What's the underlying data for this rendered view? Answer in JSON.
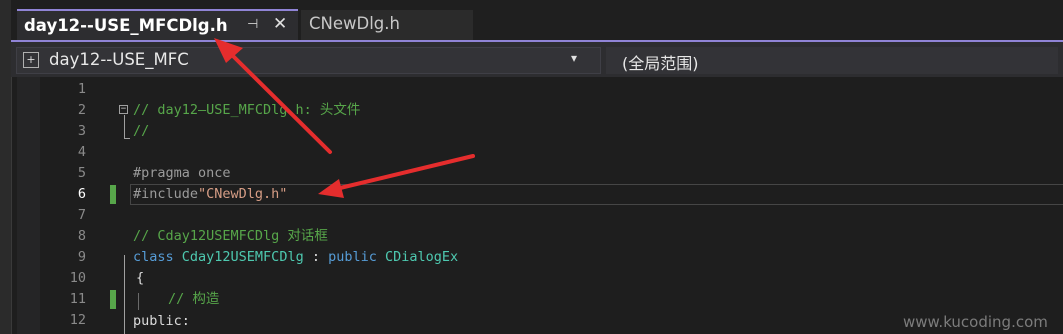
{
  "tabs": [
    {
      "label": "day12--USE_MFCDlg.h",
      "active": true,
      "pin_glyph": "⊣",
      "close_glyph": "✕"
    },
    {
      "label": "CNewDlg.h",
      "active": false
    }
  ],
  "navbar": {
    "scope": "day12--USE_MFC",
    "scope_icon": "class-scope-icon",
    "dropdown_glyph": "▾",
    "member": "(全局范围)"
  },
  "editor": {
    "current_line": 6,
    "line_numbers": [
      "1",
      "2",
      "3",
      "4",
      "5",
      "6",
      "7",
      "8",
      "9",
      "10",
      "11",
      "12"
    ],
    "lines": {
      "l2": "// day12—USE_MFCDlg.h: 头文件",
      "l3": "//",
      "l5": "#pragma once",
      "l6_directive": "#include",
      "l6_file": "\"CNewDlg.h\"",
      "l8": "// Cday12USEMFCDlg 对话框",
      "l9_kw": "class",
      "l9_name": "Cday12USEMFCDlg",
      "l9_sep": " : ",
      "l9_access": "public",
      "l9_base": "CDialogEx",
      "l10": "{",
      "l11": "// 构造",
      "l12": "public:"
    }
  },
  "colors": {
    "background": "#1e1e1e",
    "accent": "#9084d6",
    "comment": "#57a64a",
    "keyword": "#569cd6",
    "type": "#4ec9b0",
    "string": "#d69d85",
    "change_marker": "#57a64a",
    "annotation_arrow": "#e52d2d"
  },
  "watermark": "www.kucoding.com"
}
